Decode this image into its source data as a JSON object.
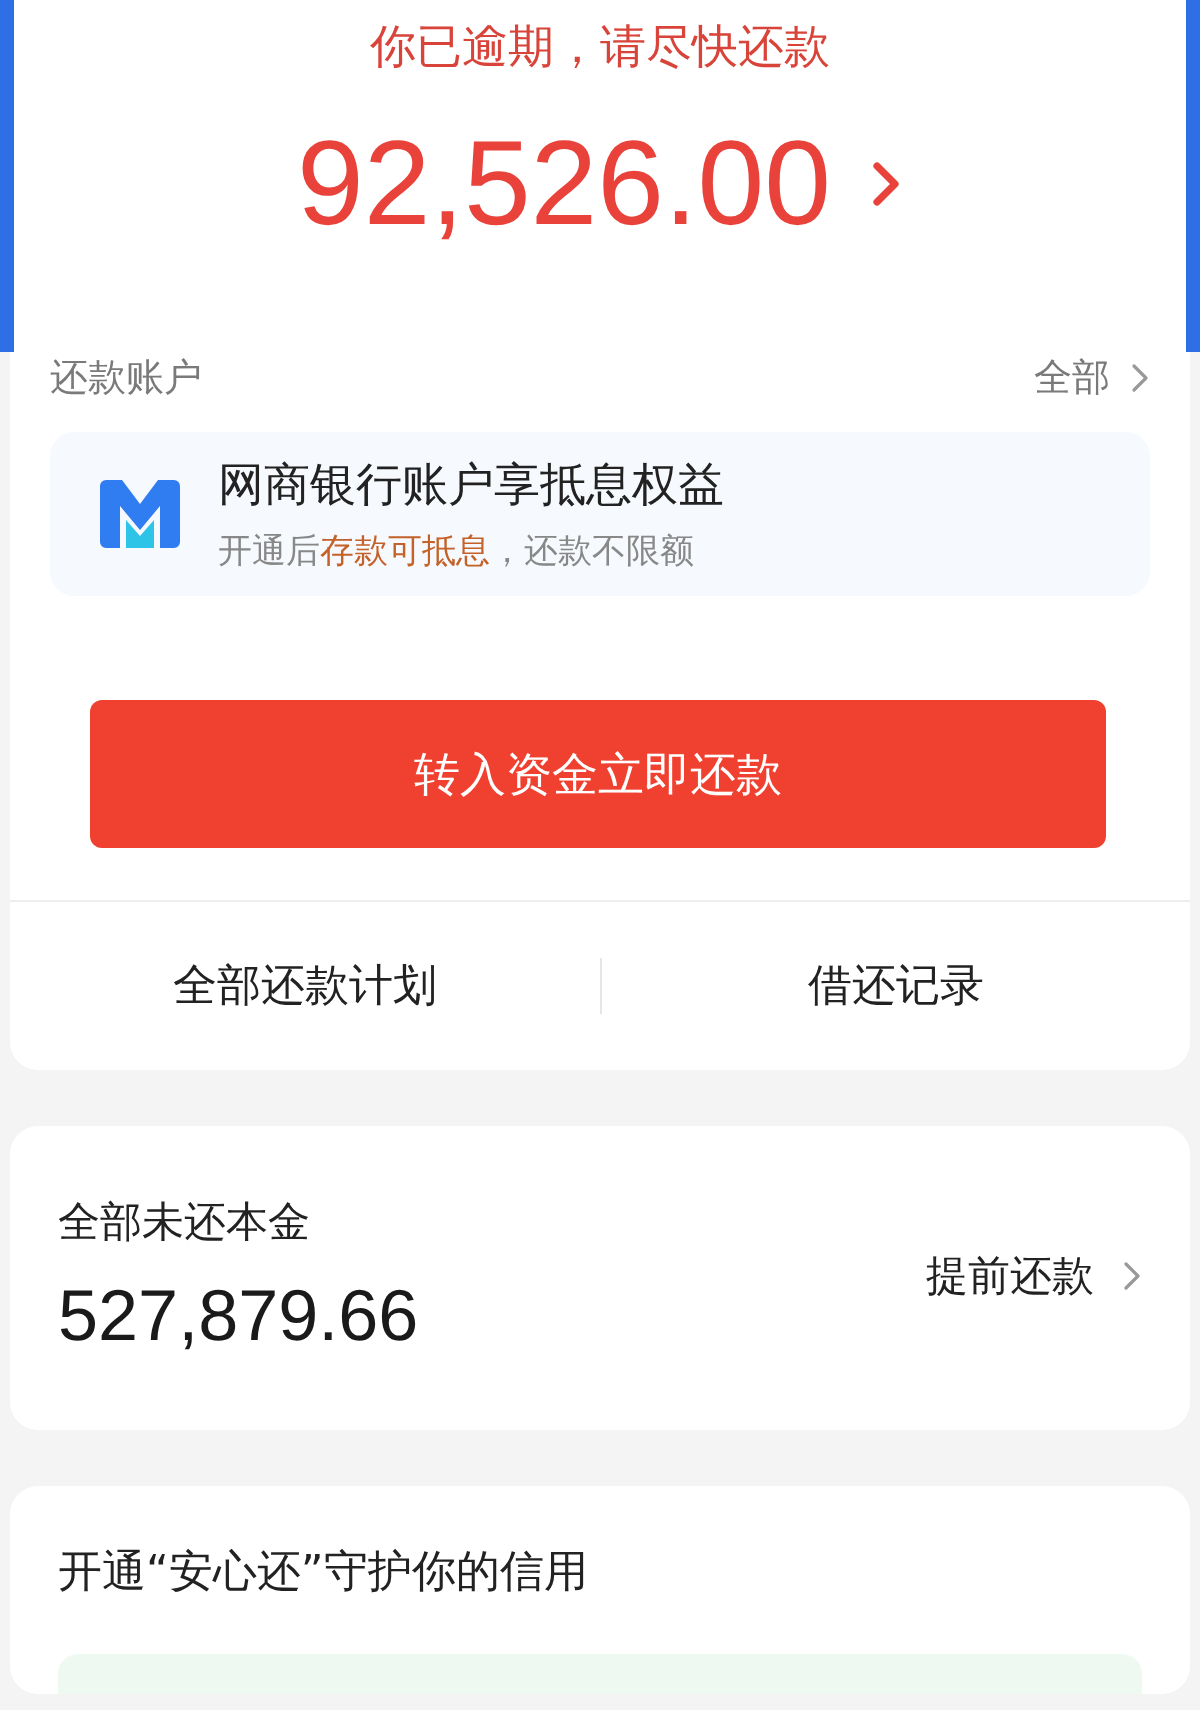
{
  "overdue_notice": "你已逾期，请尽快还款",
  "amount_due": "92,526.00",
  "repay_account": {
    "label": "还款账户",
    "link": "全部"
  },
  "bank_promo": {
    "title": "网商银行账户享抵息权益",
    "subtitle": "开通后**存款可抵息**，还款不限额"
  },
  "primary_button": "转入资金立即还款",
  "links": [
    "全部还款计划",
    "借还记录"
  ],
  "principal": {
    "label": "全部未还本金",
    "value": "527,879.66",
    "action": "提前还款"
  },
  "protection": {
    "title": "开通“安心还”守护你的信用"
  }
}
